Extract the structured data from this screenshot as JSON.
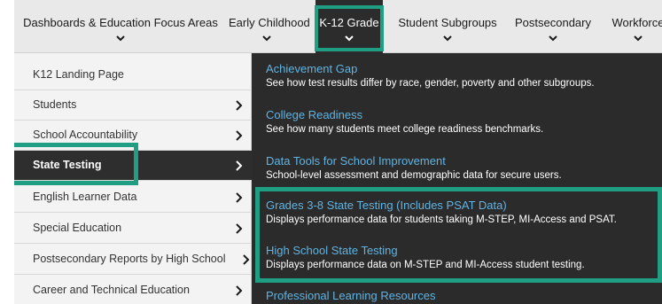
{
  "topnav": {
    "items": [
      {
        "label": "Dashboards & Education Focus Areas"
      },
      {
        "label": "Early Childhood"
      },
      {
        "label": "K-12 Grade"
      },
      {
        "label": "Student Subgroups"
      },
      {
        "label": "Postsecondary"
      },
      {
        "label": "Workforce"
      }
    ],
    "active": "K-12 Grade"
  },
  "leftmenu": {
    "items": [
      {
        "label": "K12 Landing Page"
      },
      {
        "label": "Students"
      },
      {
        "label": "School Accountability"
      },
      {
        "label": "State Testing"
      },
      {
        "label": "English Learner Data"
      },
      {
        "label": "Special Education"
      },
      {
        "label": "Postsecondary Reports by High School"
      },
      {
        "label": "Career and Technical Education"
      }
    ],
    "selected": "State Testing"
  },
  "panel": {
    "items": [
      {
        "title": "Achievement Gap",
        "desc": "See how test results differ by race, gender, poverty and other subgroups."
      },
      {
        "title": "College Readiness",
        "desc": "See how many students meet college readiness benchmarks."
      },
      {
        "title": "Data Tools for School Improvement",
        "desc": "School-level assessment and demographic data for secure users."
      },
      {
        "title": "Grades 3-8 State Testing (Includes PSAT Data)",
        "desc": "Displays performance data for students taking M-STEP, MI-Access and PSAT."
      },
      {
        "title": "High School State Testing",
        "desc": "Displays performance data on M-STEP and MI-Access student testing."
      },
      {
        "title": "Professional Learning Resources",
        "desc": ""
      }
    ]
  },
  "colors": {
    "highlight": "#1f9e83",
    "link": "#5fb4e3",
    "panel_bg": "#2b2b2b",
    "nav_bg": "#e9e9ea"
  }
}
